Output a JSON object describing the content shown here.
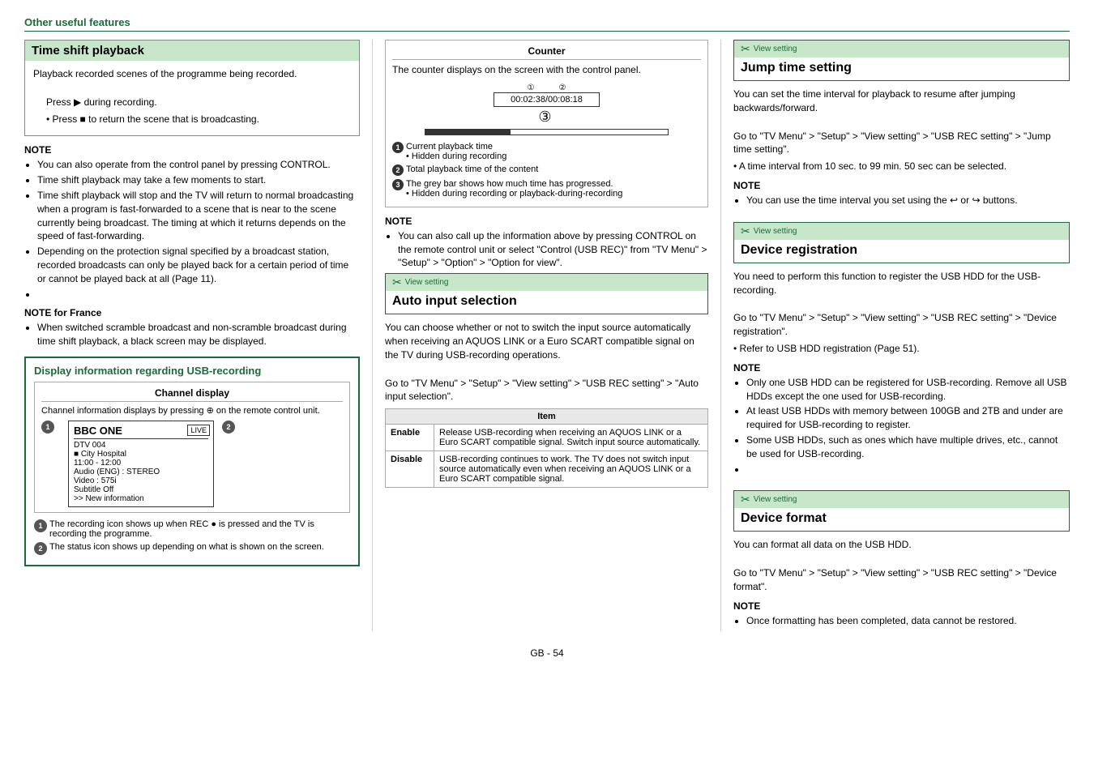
{
  "header": {
    "title": "Other useful features"
  },
  "timeshift": {
    "title": "Time shift playback",
    "description": "Playback recorded scenes of the programme being recorded.",
    "press1": "Press ▶ during recording.",
    "press2": "• Press ■ to return the scene that is broadcasting.",
    "note_title": "NOTE",
    "notes": [
      "You can also operate from the control panel by pressing CONTROL.",
      "Time shift playback may take a few moments to start.",
      "Time shift playback will stop and the TV will return to normal broadcasting when a program is fast-forwarded to a scene that is near to the scene currently being broadcast. The timing at which it returns depends on the speed of fast-forwarding.",
      "Depending on the protection signal specified by a broadcast station, recorded broadcasts can only be played back for a certain period of time or cannot be played back at all (Page 11)."
    ],
    "note_france_title": "NOTE for France",
    "notes_france": [
      "When switched scramble broadcast and non-scramble broadcast during time shift playback, a black screen may be displayed."
    ]
  },
  "display_info": {
    "title": "Display information regarding USB-recording",
    "channel_display": {
      "title": "Channel display",
      "description": "Channel information displays by pressing ⊕ on the remote control unit.",
      "screen": {
        "channel_name": "BBC ONE",
        "live_badge": "LIVE",
        "dtv": "DTV        004",
        "program": "■ City Hospital",
        "time": "11:00 - 12:00",
        "audio": "Audio (ENG) :    STEREO",
        "video": "Video        :    575i",
        "subtitle": "Subtitle         Off",
        "new_info": ">> New information"
      }
    },
    "annotations": [
      "The recording icon shows up when REC ● is pressed and the TV is recording the programme.",
      "The status icon shows up depending on what is shown on the screen."
    ]
  },
  "counter": {
    "title": "Counter",
    "description": "The counter displays on the screen with the control panel.",
    "time_display": "00:02:38/00:08:18",
    "note_title": "NOTE",
    "notes": [
      "You can also call up the information above by pressing CONTROL on the remote control unit or select \"Control (USB REC)\" from \"TV Menu\" > \"Setup\" > \"Option\" > \"Option for view\"."
    ],
    "annotations": [
      {
        "label": "Current playback time",
        "sub": "• Hidden during recording"
      },
      {
        "label": "Total playback time of the content",
        "sub": ""
      },
      {
        "label": "The grey bar shows how much time has progressed.",
        "sub": "• Hidden during recording or playback-during-recording"
      }
    ]
  },
  "auto_input": {
    "view_setting_label": "View setting",
    "title": "Auto input selection",
    "description": "You can choose whether or not to switch the input source automatically when receiving an AQUOS LINK or a Euro SCART compatible signal on the TV during USB-recording operations.",
    "instruction": "Go to \"TV Menu\" > \"Setup\" > \"View setting\" > \"USB REC setting\" > \"Auto input selection\".",
    "table": {
      "header": "Item",
      "rows": [
        {
          "label": "Enable",
          "description": "Release USB-recording when receiving an AQUOS LINK or a Euro SCART compatible signal. Switch input source automatically."
        },
        {
          "label": "Disable",
          "description": "USB-recording continues to work. The TV does not switch input source automatically even when receiving an AQUOS LINK or a Euro SCART compatible signal."
        }
      ]
    }
  },
  "jump_time": {
    "view_setting_label": "View setting",
    "title": "Jump time setting",
    "description": "You can set the time interval for playback to resume after jumping backwards/forward.",
    "instruction_1": "Go to \"TV Menu\" > \"Setup\" > \"View setting\" > \"USB REC setting\" > \"Jump time setting\".",
    "instruction_2": "• A time interval from 10 sec. to 99 min. 50 sec can be selected.",
    "note_title": "NOTE",
    "notes": [
      "You can use the time interval you set using the ↩ or ↪ buttons."
    ]
  },
  "device_registration": {
    "view_setting_label": "View setting",
    "title": "Device registration",
    "description": "You need to perform this function to register the USB HDD for the USB-recording.",
    "instruction_1": "Go to \"TV Menu\" > \"Setup\" > \"View setting\" > \"USB REC setting\" > \"Device registration\".",
    "instruction_2": "• Refer to USB HDD registration (Page 51).",
    "note_title": "NOTE",
    "notes": [
      "Only one USB HDD can be registered for USB-recording. Remove all USB HDDs except the one used for USB-recording.",
      "At least USB HDDs with memory between 100GB and 2TB and under are required for USB-recording to register.",
      "Some USB HDDs, such as ones which have multiple drives, etc., cannot be used for USB-recording."
    ]
  },
  "device_format": {
    "view_setting_label": "View setting",
    "title": "Device format",
    "description": "You can format all data on the USB HDD.",
    "instruction": "Go to \"TV Menu\" > \"Setup\" > \"View setting\" > \"USB REC setting\" > \"Device format\".",
    "note_title": "NOTE",
    "notes": [
      "Once formatting has been completed, data cannot be restored."
    ]
  },
  "footer": {
    "text": "GB - 54"
  }
}
